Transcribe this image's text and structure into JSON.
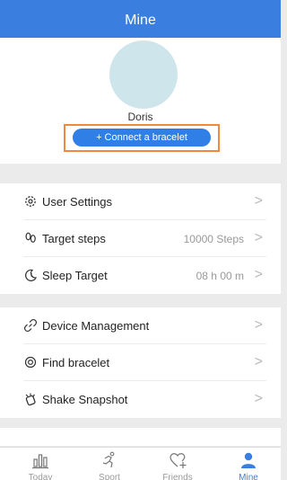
{
  "header": {
    "title": "Mine"
  },
  "profile": {
    "name": "Doris",
    "connect_label": "+ Connect a bracelet"
  },
  "settings": {
    "user_settings": "User Settings",
    "target_steps": "Target steps",
    "target_steps_value": "10000 Steps",
    "sleep_target": "Sleep Target",
    "sleep_target_value": "08 h 00 m"
  },
  "device": {
    "device_management": "Device Management",
    "find_bracelet": "Find bracelet",
    "shake_snapshot": "Shake Snapshot"
  },
  "chevron": ">",
  "tabs": [
    {
      "label": "Today",
      "icon": "bar-chart-icon"
    },
    {
      "label": "Sport",
      "icon": "running-icon"
    },
    {
      "label": "Friends",
      "icon": "heart-add-icon"
    },
    {
      "label": "Mine",
      "icon": "person-icon",
      "active": true
    }
  ],
  "colors": {
    "accent": "#3a7ee0",
    "highlight_border": "#f0893b",
    "avatar": "#cfe5ec"
  }
}
